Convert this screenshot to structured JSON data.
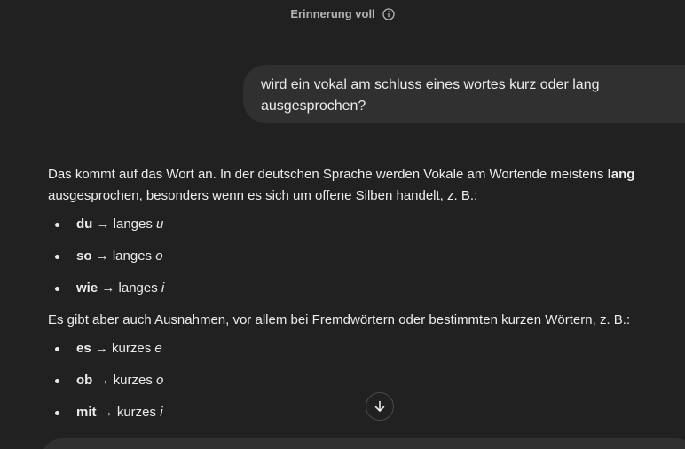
{
  "memory_banner": {
    "label": "Erinnerung voll",
    "icon": "info-icon"
  },
  "user_message": "wird ein vokal am schluss eines wortes kurz oder lang ausgesprochen?",
  "assistant": {
    "intro_before_bold": "Das kommt auf das Wort an. In der deutschen Sprache werden Vokale am Wortende meistens ",
    "intro_bold": "lang",
    "intro_after_bold": " ausgesprochen, besonders wenn es sich um offene Silben handelt, z. B.:",
    "long_examples": [
      {
        "word": "du",
        "arrow_text": " → langes ",
        "vowel": "u"
      },
      {
        "word": "so",
        "arrow_text": " → langes ",
        "vowel": "o"
      },
      {
        "word": "wie",
        "arrow_text": " → langes ",
        "vowel": "i"
      }
    ],
    "exceptions_intro": "Es gibt aber auch Ausnahmen, vor allem bei Fremdwörtern oder bestimmten kurzen Wörtern, z. B.:",
    "short_examples": [
      {
        "word": "es",
        "arrow_text": " → kurzes ",
        "vowel": "e"
      },
      {
        "word": "ob",
        "arrow_text": " → kurzes ",
        "vowel": "o"
      },
      {
        "word": "mit",
        "arrow_text": " → kurzes ",
        "vowel": "i"
      }
    ]
  },
  "scroll_button": {
    "icon": "arrow-down-icon"
  }
}
